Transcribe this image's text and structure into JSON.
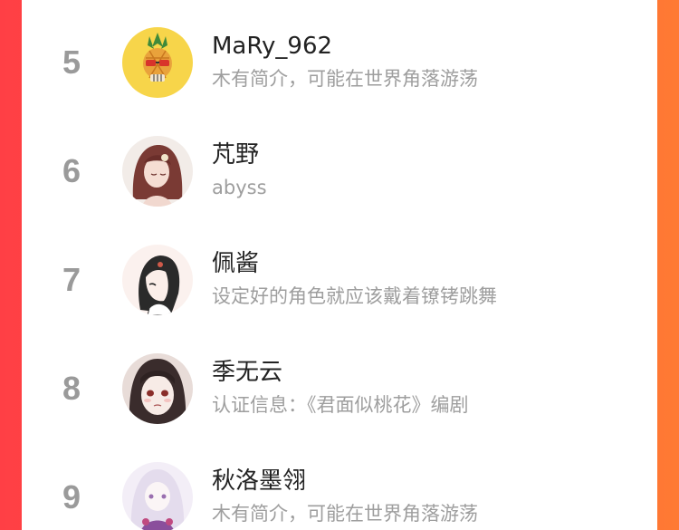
{
  "ranking": {
    "items": [
      {
        "rank": "5",
        "name": "MaRy_962",
        "bio": "木有简介，可能在世界角落游荡",
        "avatar_icon": "pineapple-skull-avatar"
      },
      {
        "rank": "6",
        "name": "芃野",
        "bio": "abyss",
        "avatar_icon": "anime-girl-red-hair-avatar"
      },
      {
        "rank": "7",
        "name": "佩酱",
        "bio": "设定好的角色就应该戴着镣铐跳舞",
        "avatar_icon": "anime-girl-sketch-avatar"
      },
      {
        "rank": "8",
        "name": "季无云",
        "bio": "认证信息：《君面似桃花》编剧",
        "avatar_icon": "anime-girl-black-hair-avatar"
      },
      {
        "rank": "9",
        "name": "秋洛墨翎",
        "bio": "木有简介，可能在世界角落游荡",
        "avatar_icon": "anime-girl-white-hair-avatar"
      }
    ]
  },
  "colors": {
    "background_left": "#ff3f45",
    "background_right": "#ff7a33",
    "rank_text": "#9a9a9a",
    "name_text": "#222222",
    "bio_text": "#9e9e9e"
  }
}
